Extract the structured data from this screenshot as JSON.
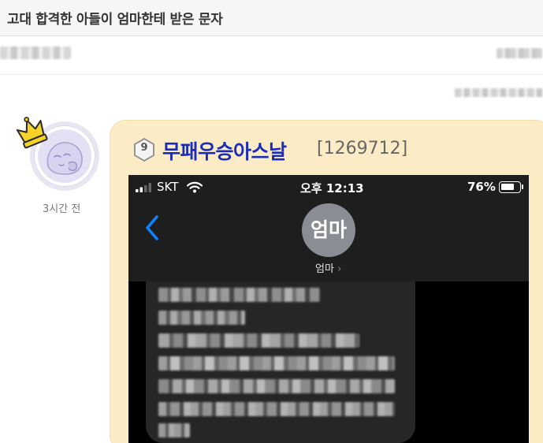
{
  "post": {
    "title": "고대 합격한 아들이 엄마한테 받은 문자",
    "timestamp": "3시간 전"
  },
  "image_post": {
    "level_badge": "9",
    "nickname": "무패우승아스날",
    "post_id": "[1269712]"
  },
  "phone": {
    "carrier": "SKT",
    "time": "오후 12:13",
    "battery": "76%",
    "battery_level": 0.76,
    "contact_initials": "엄마",
    "contact_name": "엄마",
    "contact_chevron": "›"
  },
  "icons": {
    "crown": "crown-icon",
    "avatar": "sleeping-animal-avatar",
    "level_badge": "hexagon-badge-icon",
    "signal": "cellular-signal-icon",
    "wifi": "wifi-icon",
    "battery": "battery-icon",
    "back": "chevron-left-icon"
  },
  "colors": {
    "nickname": "#1a2cb8",
    "card_background": "#fcecc6",
    "ios_blue": "#0a84ff",
    "crown": "#f5d327"
  }
}
